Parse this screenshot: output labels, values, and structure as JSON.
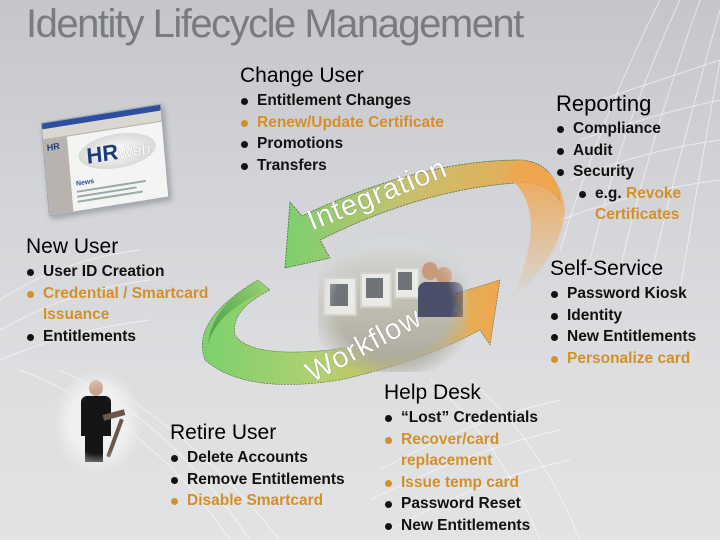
{
  "title": "Identity Lifecycle Management",
  "colors": {
    "highlight_text": "#d58f2a",
    "title_text": "#7a7b7d",
    "arrow_green": "#7cd06e",
    "arrow_orange": "#f0a64e"
  },
  "cycle_labels": {
    "integration": "Integration",
    "workflow": "Workflow"
  },
  "images": {
    "hr_logo": "HR",
    "hr_logo_suffix": "Web",
    "hr_mini": "HR",
    "hr_news": "News"
  },
  "sections": {
    "change_user": {
      "heading": "Change User",
      "items": [
        {
          "text": "Entitlement Changes",
          "highlight": false
        },
        {
          "text": "Renew/Update Certificate",
          "highlight": true
        },
        {
          "text": "Promotions",
          "highlight": false
        },
        {
          "text": "Transfers",
          "highlight": false
        }
      ]
    },
    "reporting": {
      "heading": "Reporting",
      "items": [
        {
          "text": "Compliance",
          "highlight": false
        },
        {
          "text": "Audit",
          "highlight": false
        },
        {
          "text": "Security",
          "highlight": false
        }
      ],
      "sub_item": {
        "prefix": "e.g. ",
        "accent": "Revoke Certificates"
      }
    },
    "new_user": {
      "heading": "New User",
      "items": [
        {
          "text": "User ID Creation",
          "highlight": false
        },
        {
          "text": "Credential / Smartcard Issuance",
          "highlight": true
        },
        {
          "text": "Entitlements",
          "highlight": false
        }
      ]
    },
    "self_service": {
      "heading": "Self-Service",
      "items": [
        {
          "text": "Password Kiosk",
          "highlight": false
        },
        {
          "text": "Identity",
          "highlight": false
        },
        {
          "text": "New Entitlements",
          "highlight": false
        },
        {
          "text": "Personalize card",
          "highlight": true
        }
      ]
    },
    "help_desk": {
      "heading": "Help Desk",
      "items": [
        {
          "text": "“Lost” Credentials",
          "highlight": false
        },
        {
          "text": "Recover/card replacement",
          "highlight": true
        },
        {
          "text": "Issue temp card",
          "highlight": true
        },
        {
          "text": "Password Reset",
          "highlight": false
        },
        {
          "text": "New Entitlements",
          "highlight": false
        }
      ]
    },
    "retire_user": {
      "heading": "Retire User",
      "items": [
        {
          "text": "Delete Accounts",
          "highlight": false
        },
        {
          "text": "Remove Entitlements",
          "highlight": false
        },
        {
          "text": "Disable Smartcard",
          "highlight": true
        }
      ]
    }
  }
}
